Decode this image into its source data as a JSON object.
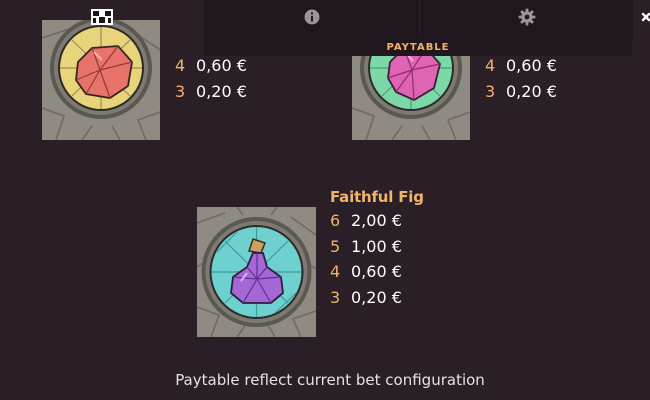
{
  "tabs": {
    "paytable": {
      "icon": "paytable-icon",
      "active": true
    },
    "info": {
      "icon": "info-icon"
    },
    "settings": {
      "icon": "gear-icon"
    },
    "close": {
      "icon": "close-icon"
    }
  },
  "section_label": "PAYTABLE",
  "symbols": [
    {
      "name": "",
      "gem": "red-gem",
      "accent_color": "#e8d47a",
      "pays": [
        {
          "count": "4",
          "amount": "0,60 €"
        },
        {
          "count": "3",
          "amount": "0,20 €"
        }
      ]
    },
    {
      "name": "",
      "gem": "pink-gem",
      "accent_color": "#7cd8a6",
      "pays": [
        {
          "count": "4",
          "amount": "0,60 €"
        },
        {
          "count": "3",
          "amount": "0,20 €"
        }
      ]
    },
    {
      "name": "Faithful Fig",
      "gem": "purple-fig",
      "accent_color": "#6fd1cf",
      "pays": [
        {
          "count": "6",
          "amount": "2,00 €"
        },
        {
          "count": "5",
          "amount": "1,00 €"
        },
        {
          "count": "4",
          "amount": "0,60 €"
        },
        {
          "count": "3",
          "amount": "0,20 €"
        }
      ]
    }
  ],
  "footer": "Paytable reflect current bet configuration",
  "colors": {
    "background": "#2a1e27",
    "tab_background": "#1f171d",
    "accent": "#f2b46a",
    "text": "#ffffff"
  }
}
